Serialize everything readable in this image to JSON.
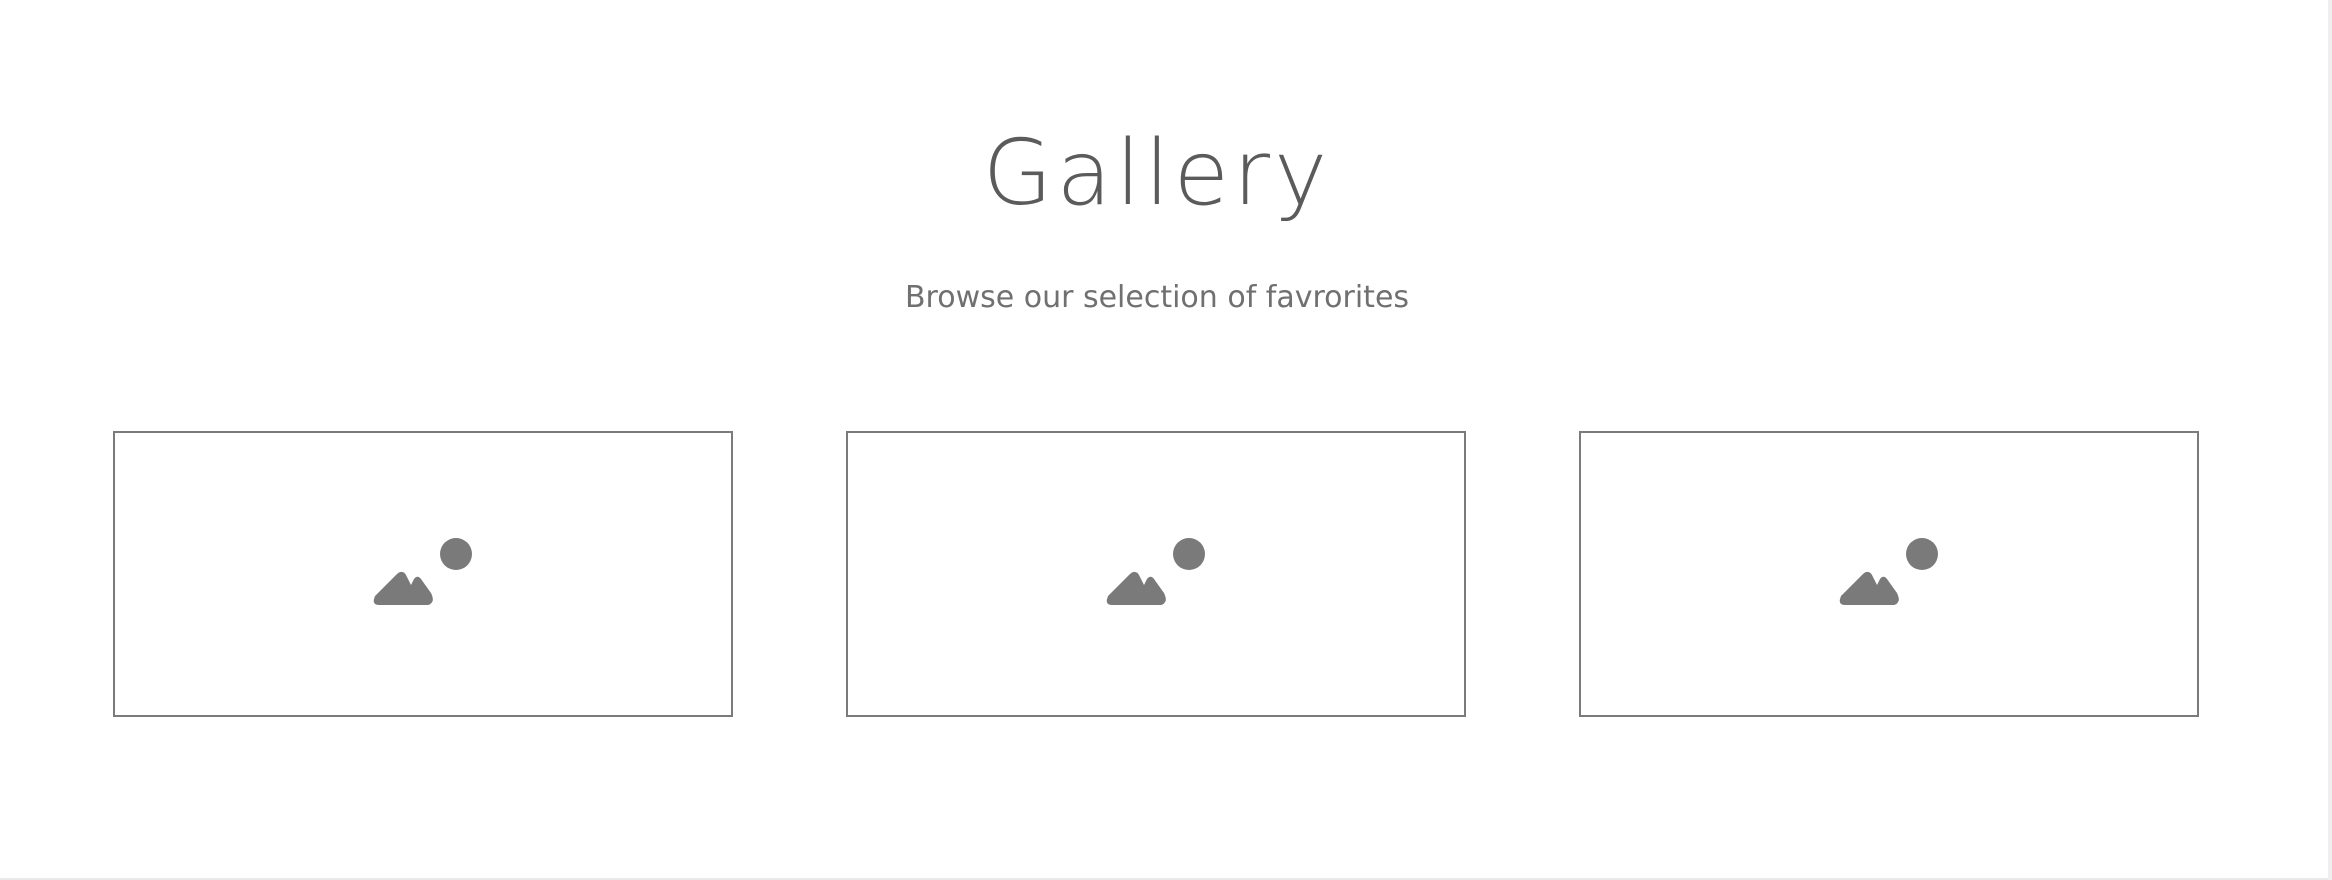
{
  "gallery": {
    "title": "Gallery",
    "subtitle": "Browse our selection of favrorites",
    "items": [
      {
        "icon": "image-placeholder-icon"
      },
      {
        "icon": "image-placeholder-icon"
      },
      {
        "icon": "image-placeholder-icon"
      }
    ]
  },
  "colors": {
    "text": "#5b5b5b",
    "subtitle": "#707070",
    "border": "#7b7b7b",
    "icon": "#7a7a7a",
    "background": "#ffffff"
  }
}
